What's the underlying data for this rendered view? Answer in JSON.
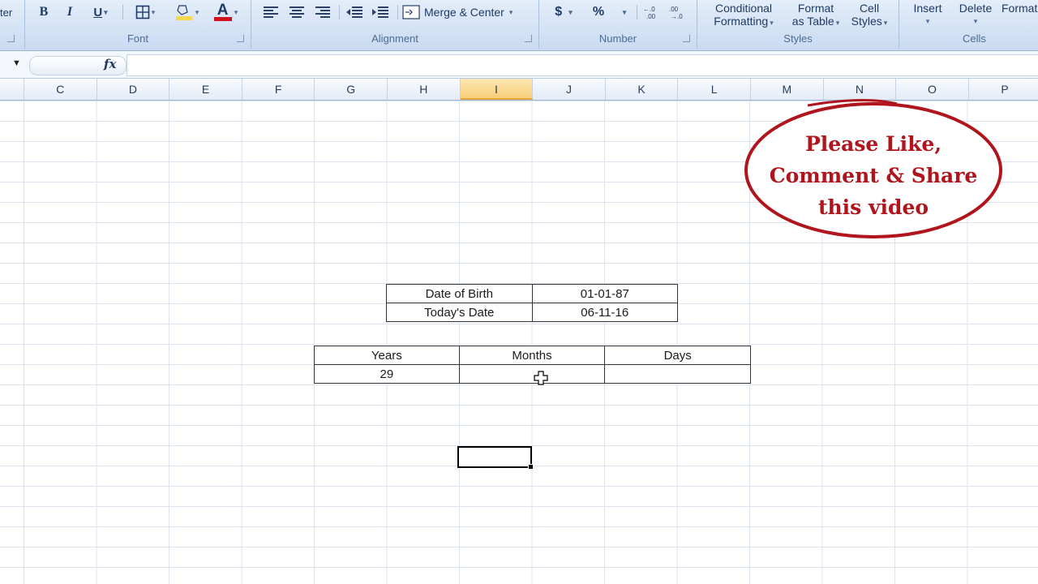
{
  "ribbon": {
    "clipboard_fragment": "ter",
    "font": {
      "bold": "B",
      "italic": "I",
      "underline": "U",
      "font_color_letter": "A",
      "label": "Font",
      "font_color": "#d0101c",
      "fill_color": "#f5d94a"
    },
    "alignment": {
      "merge_label": "Merge & Center",
      "label": "Alignment"
    },
    "number": {
      "currency": "$",
      "percent": "%",
      "label": "Number"
    },
    "styles": {
      "conditional_line1": "Conditional",
      "conditional_line2": "Formatting",
      "format_table_line1": "Format",
      "format_table_line2": "as Table",
      "cell_styles_line1": "Cell",
      "cell_styles_line2": "Styles",
      "label": "Styles"
    },
    "cells": {
      "insert": "Insert",
      "delete": "Delete",
      "format": "Format",
      "label": "Cells"
    }
  },
  "formula_bar": {
    "fx": "fx",
    "value": ""
  },
  "columns": [
    "C",
    "D",
    "E",
    "F",
    "G",
    "H",
    "I",
    "J",
    "K",
    "L",
    "M",
    "N",
    "O",
    "P"
  ],
  "active_column": "I",
  "dates_table": [
    {
      "label": "Date of Birth",
      "value": "01-01-87"
    },
    {
      "label": "Today's Date",
      "value": "06-11-16"
    }
  ],
  "result_table": {
    "headers": [
      "Years",
      "Months",
      "Days"
    ],
    "values": [
      "29",
      "",
      ""
    ]
  },
  "callout": {
    "line1": "Please Like,",
    "line2": "Comment & Share",
    "line3": "this video",
    "color": "#b0141c"
  }
}
